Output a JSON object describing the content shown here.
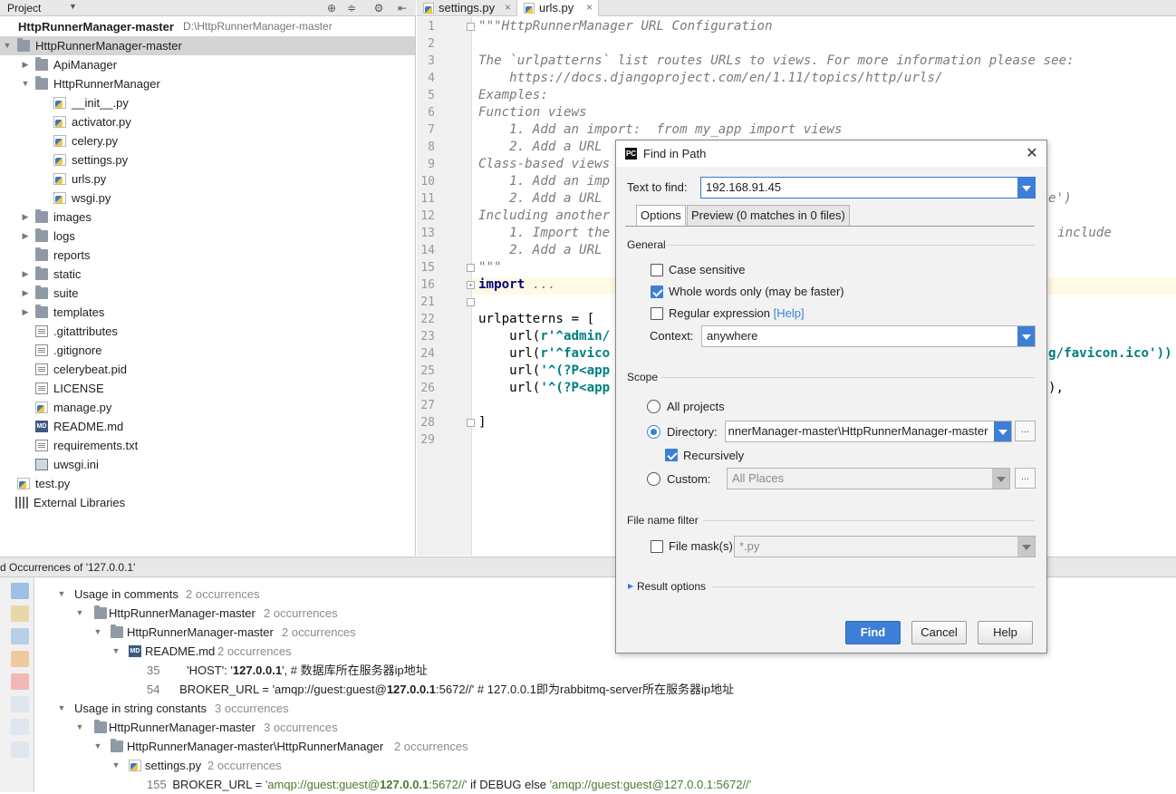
{
  "project": {
    "title": "Project",
    "root_name": "HttpRunnerManager-master",
    "root_path": "D:\\HttpRunnerManager-master",
    "tree": [
      {
        "label": "HttpRunnerManager-master",
        "icon": "folder-icon"
      },
      {
        "label": "ApiManager",
        "icon": "folder-icon"
      },
      {
        "label": "HttpRunnerManager",
        "icon": "folder-icon"
      },
      {
        "label": "__init__.py",
        "icon": "python-file-icon"
      },
      {
        "label": "activator.py",
        "icon": "python-file-icon"
      },
      {
        "label": "celery.py",
        "icon": "python-file-icon"
      },
      {
        "label": "settings.py",
        "icon": "python-file-icon"
      },
      {
        "label": "urls.py",
        "icon": "python-file-icon"
      },
      {
        "label": "wsgi.py",
        "icon": "python-file-icon"
      },
      {
        "label": "images",
        "icon": "folder-icon"
      },
      {
        "label": "logs",
        "icon": "folder-icon"
      },
      {
        "label": "reports",
        "icon": "folder-icon"
      },
      {
        "label": "static",
        "icon": "folder-icon"
      },
      {
        "label": "suite",
        "icon": "folder-icon"
      },
      {
        "label": "templates",
        "icon": "folder-icon"
      },
      {
        "label": ".gitattributes",
        "icon": "text-file-icon"
      },
      {
        "label": ".gitignore",
        "icon": "text-file-icon"
      },
      {
        "label": "celerybeat.pid",
        "icon": "text-file-icon"
      },
      {
        "label": "LICENSE",
        "icon": "text-file-icon"
      },
      {
        "label": "manage.py",
        "icon": "python-file-icon"
      },
      {
        "label": "README.md",
        "icon": "markdown-file-icon"
      },
      {
        "label": "requirements.txt",
        "icon": "text-file-icon"
      },
      {
        "label": "uwsgi.ini",
        "icon": "ini-file-icon"
      },
      {
        "label": "test.py",
        "icon": "python-file-icon"
      },
      {
        "label": "External Libraries",
        "icon": "libraries-icon"
      }
    ]
  },
  "editor": {
    "tabs": [
      {
        "label": "settings.py",
        "active": false
      },
      {
        "label": "urls.py",
        "active": true
      }
    ],
    "close_glyph": "×",
    "line_numbers": [
      "1",
      "2",
      "3",
      "4",
      "5",
      "6",
      "7",
      "8",
      "9",
      "10",
      "11",
      "12",
      "13",
      "14",
      "15",
      "16",
      "21",
      "22",
      "23",
      "24",
      "25",
      "26",
      "27",
      "28",
      "29"
    ],
    "docstring": [
      "\"\"\"HttpRunnerManager URL Configuration",
      "",
      "The `urlpatterns` list routes URLs to views. For more information please see:",
      "    https://docs.djangoproject.com/en/1.11/topics/http/urls/",
      "Examples:",
      "Function views",
      "    1. Add an import:  from my_app import views",
      "    2. Add a URL",
      "Class-based views",
      "    1. Add an imp",
      "    2. Add a URL",
      "Including another",
      "    1. Import the",
      "    2. Add a URL",
      "\"\"\""
    ],
    "right_fragments": {
      "line11": "e')",
      "line13": ", include",
      "line24": "g/favicon.ico'))",
      "line26": "),"
    },
    "import_kw": "import",
    "import_rest": " ...",
    "urlpatterns": "urlpatterns = [",
    "url_lines": [
      {
        "fn": "    url(",
        "str": "r'^admin/"
      },
      {
        "fn": "    url(",
        "str": "r'^favico"
      },
      {
        "fn": "    url(",
        "str": "'^(?P<app"
      },
      {
        "fn": "    url(",
        "str": "'^(?P<app"
      }
    ],
    "close_bracket": "]"
  },
  "find_panel": {
    "title": "d Occurrences of '127.0.0.1'",
    "groups": [
      {
        "label": "Usage in comments",
        "count": "2 occurrences"
      },
      {
        "label": "HttpRunnerManager-master",
        "count": "2 occurrences"
      },
      {
        "label": "HttpRunnerManager-master",
        "count": "2 occurrences"
      },
      {
        "label": "README.md",
        "count": "2 occurrences"
      },
      {
        "label": "Usage in string constants",
        "count": "3 occurrences"
      },
      {
        "label": "HttpRunnerManager-master",
        "count": "3 occurrences"
      },
      {
        "label": "HttpRunnerManager-master\\HttpRunnerManager",
        "count": "2 occurrences"
      },
      {
        "label": "settings.py",
        "count": "2 occurrences"
      }
    ],
    "lines": [
      {
        "num": "35",
        "pre": "'HOST': '",
        "hit": "127.0.0.1",
        "post": "',  # 数据库所在服务器ip地址"
      },
      {
        "num": "54",
        "pre": "BROKER_URL = 'amqp://guest:guest@",
        "hit": "127.0.0.1",
        "post": ":5672//'  # 127.0.0.1即为rabbitmq-server所在服务器ip地址"
      },
      {
        "num": "155",
        "pre": "BROKER_URL = ",
        "str1": "'amqp://guest:guest@",
        "hit": "127.0.0.1",
        "str2": ":5672//'",
        "mid": " if DEBUG else ",
        "str3": "'amqp://guest:guest@127.0.0.1:5672//'"
      }
    ]
  },
  "dialog": {
    "title": "Find in Path",
    "logo_text": "PC",
    "close_glyph": "✕",
    "text_to_find_label": "Text to find:",
    "text_to_find_value": "192.168.91.45",
    "tabs": [
      "Options",
      "Preview (0 matches in 0 files)"
    ],
    "general_label": "General",
    "case_sensitive": {
      "label": "Case sensitive",
      "checked": false
    },
    "whole_words": {
      "label": "Whole words only (may be faster)",
      "checked": true
    },
    "regex": {
      "label": "Regular expression",
      "checked": false,
      "help": "[Help]"
    },
    "context_label": "Context:",
    "context_value": "anywhere",
    "scope_label": "Scope",
    "all_projects": "All projects",
    "directory_label": "Directory:",
    "directory_value": " nnerManager-master\\HttpRunnerManager-master",
    "recursively": {
      "label": "Recursively",
      "checked": true
    },
    "custom_label": "Custom:",
    "custom_value": "All Places",
    "ellipsis": "...",
    "file_name_filter_label": "File name filter",
    "file_mask": {
      "label": "File mask(s)",
      "checked": false,
      "value": "*.py"
    },
    "result_options": "Result options",
    "buttons": {
      "find": "Find",
      "cancel": "Cancel",
      "help": "Help"
    }
  }
}
